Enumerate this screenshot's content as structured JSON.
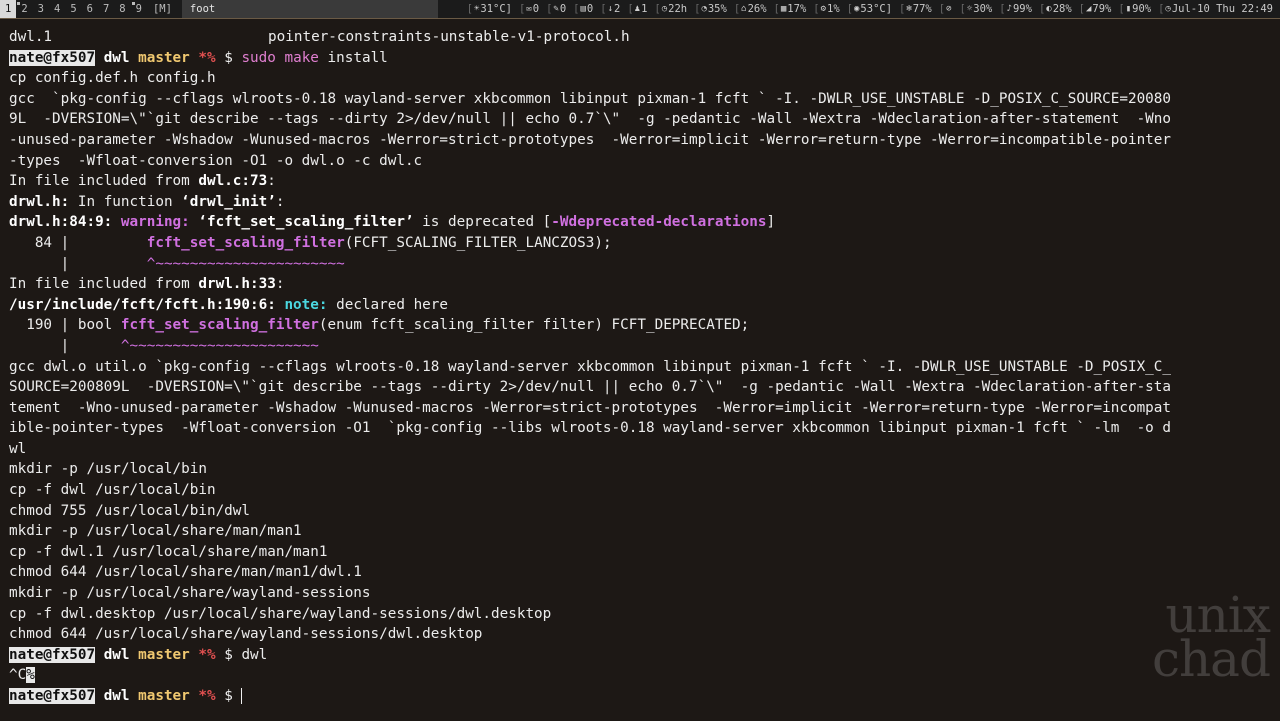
{
  "statusbar": {
    "tags": [
      {
        "label": "1",
        "state": "active"
      },
      {
        "label": "2",
        "state": "occupied"
      },
      {
        "label": "3",
        "state": "normal"
      },
      {
        "label": "4",
        "state": "normal"
      },
      {
        "label": "5",
        "state": "normal"
      },
      {
        "label": "6",
        "state": "normal"
      },
      {
        "label": "7",
        "state": "normal"
      },
      {
        "label": "8",
        "state": "normal"
      },
      {
        "label": "9",
        "state": "occupied"
      }
    ],
    "layout": "[M]",
    "window_title": "foot",
    "blocks": [
      {
        "icon": "thermometer-icon",
        "glyph": "☀",
        "text": "31°C]"
      },
      {
        "icon": "mail-icon",
        "glyph": "✉",
        "text": "0"
      },
      {
        "icon": "chat-icon",
        "glyph": "✎",
        "text": "0"
      },
      {
        "icon": "news-icon",
        "glyph": "▤",
        "text": "0"
      },
      {
        "icon": "download-icon",
        "glyph": "↓",
        "text": "2"
      },
      {
        "icon": "user-icon",
        "glyph": "♟",
        "text": "1"
      },
      {
        "icon": "uptime-icon",
        "glyph": "◷",
        "text": "22h"
      },
      {
        "icon": "disk-icon",
        "glyph": "◔",
        "text": "35%"
      },
      {
        "icon": "home-icon",
        "glyph": "⌂",
        "text": "26%"
      },
      {
        "icon": "memory-icon",
        "glyph": "▦",
        "text": "17%"
      },
      {
        "icon": "cpu-icon",
        "glyph": "⚙",
        "text": "1%"
      },
      {
        "icon": "cpu-temp-icon",
        "glyph": "◉",
        "text": "53°C]"
      },
      {
        "icon": "fan-icon",
        "glyph": "❄",
        "text": "77%"
      },
      {
        "icon": "mic-muted-icon",
        "glyph": "⊘",
        "text": ""
      },
      {
        "icon": "brightness-icon",
        "glyph": "☼",
        "text": "30%"
      },
      {
        "icon": "volume-muted-icon",
        "glyph": "♪",
        "text": "99%"
      },
      {
        "icon": "battery-icon",
        "glyph": "◐",
        "text": "28%"
      },
      {
        "icon": "wifi-icon",
        "glyph": "◢",
        "text": "79%"
      },
      {
        "icon": "battery2-icon",
        "glyph": "▮",
        "text": "90%"
      },
      {
        "icon": "clock-icon",
        "glyph": "◷",
        "text": "Jul-10 Thu 22:49"
      }
    ]
  },
  "terminal": {
    "prompt": {
      "user_host": "nate@fx507",
      "dir": "dwl",
      "branch": "master",
      "dirty": "*%",
      "symbol": "$"
    },
    "lines": {
      "l01a": "dwl.1",
      "l01b": "pointer-constraints-unstable-v1-protocol.h",
      "l02_cmd_sudo": "sudo",
      "l02_cmd_make": "make",
      "l02_cmd_rest": " install",
      "l03": "cp config.def.h config.h",
      "l04": "gcc  `pkg-config --cflags wlroots-0.18 wayland-server xkbcommon libinput pixman-1 fcft ` -I. -DWLR_USE_UNSTABLE -D_POSIX_C_SOURCE=20080",
      "l05": "9L  -DVERSION=\\\"`git describe --tags --dirty 2>/dev/null || echo 0.7`\\\"  -g -pedantic -Wall -Wextra -Wdeclaration-after-statement  -Wno",
      "l06": "-unused-parameter -Wshadow -Wunused-macros -Werror=strict-prototypes  -Werror=implicit -Werror=return-type -Werror=incompatible-pointer",
      "l07": "-types  -Wfloat-conversion -O1 -o dwl.o -c dwl.c",
      "l08a": "In file included from ",
      "l08b": "dwl.c:73",
      "l08c": ":",
      "l09a": "drwl.h:",
      "l09b": " In function ",
      "l09c": "‘drwl_init’",
      "l09d": ":",
      "l10a": "drwl.h:84:9:",
      "l10b": " warning: ",
      "l10c": "‘fcft_set_scaling_filter’",
      "l10d": " is deprecated [",
      "l10e": "-Wdeprecated-declarations",
      "l10f": "]",
      "l11a": "   84 |         ",
      "l11b": "fcft_set_scaling_filter",
      "l11c": "(FCFT_SCALING_FILTER_LANCZOS3);",
      "l12a": "      |         ",
      "l12b": "^~~~~~~~~~~~~~~~~~~~~~~",
      "l13a": "In file included from ",
      "l13b": "drwl.h:33",
      "l13c": ":",
      "l14a": "/usr/include/fcft/fcft.h:190:6:",
      "l14b": " note: ",
      "l14c": "declared here",
      "l15a": "  190 | bool ",
      "l15b": "fcft_set_scaling_filter",
      "l15c": "(enum fcft_scaling_filter filter) FCFT_DEPRECATED;",
      "l16a": "      |      ",
      "l16b": "^~~~~~~~~~~~~~~~~~~~~~~",
      "l17": "gcc dwl.o util.o `pkg-config --cflags wlroots-0.18 wayland-server xkbcommon libinput pixman-1 fcft ` -I. -DWLR_USE_UNSTABLE -D_POSIX_C_",
      "l18": "SOURCE=200809L  -DVERSION=\\\"`git describe --tags --dirty 2>/dev/null || echo 0.7`\\\"  -g -pedantic -Wall -Wextra -Wdeclaration-after-sta",
      "l19": "tement  -Wno-unused-parameter -Wshadow -Wunused-macros -Werror=strict-prototypes  -Werror=implicit -Werror=return-type -Werror=incompat",
      "l20": "ible-pointer-types  -Wfloat-conversion -O1  `pkg-config --libs wlroots-0.18 wayland-server xkbcommon libinput pixman-1 fcft ` -lm  -o d",
      "l21": "wl",
      "l22": "mkdir -p /usr/local/bin",
      "l23": "cp -f dwl /usr/local/bin",
      "l24": "chmod 755 /usr/local/bin/dwl",
      "l25": "mkdir -p /usr/local/share/man/man1",
      "l26": "cp -f dwl.1 /usr/local/share/man/man1",
      "l27": "chmod 644 /usr/local/share/man/man1/dwl.1",
      "l28": "mkdir -p /usr/local/share/wayland-sessions",
      "l29": "cp -f dwl.desktop /usr/local/share/wayland-sessions/dwl.desktop",
      "l30": "chmod 644 /usr/local/share/wayland-sessions/dwl.desktop",
      "l31_cmd": "dwl",
      "l32a": "^C",
      "l32b": "%"
    }
  },
  "watermark": {
    "line1": "unix",
    "line2": "chad"
  }
}
